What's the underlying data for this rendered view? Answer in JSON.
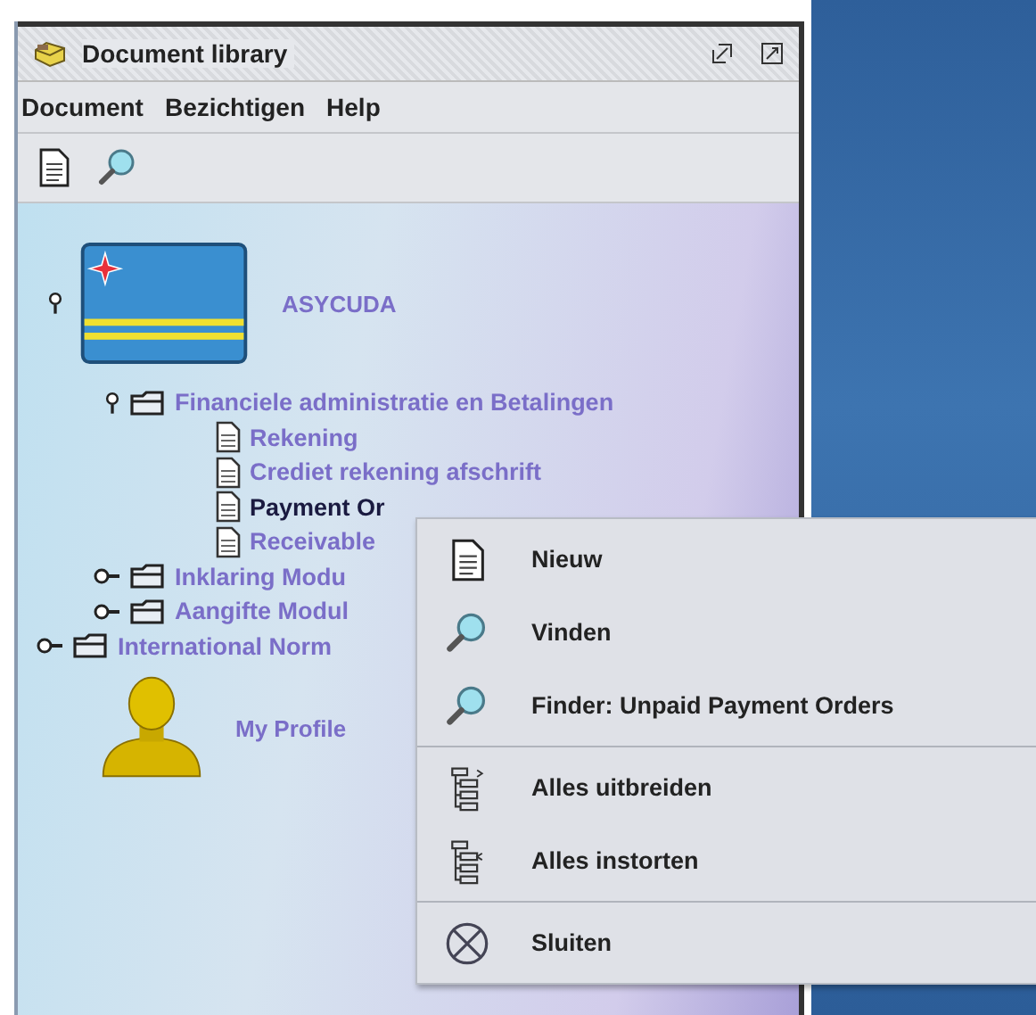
{
  "window": {
    "title": "Document library"
  },
  "menu_bar": [
    {
      "label": "Document"
    },
    {
      "label": "Bezichtigen"
    },
    {
      "label": "Help"
    }
  ],
  "toolbar": [
    {
      "kind": "new"
    },
    {
      "kind": "find"
    }
  ],
  "tree": [
    {
      "kind": "flag",
      "label": "ASYCUDA",
      "expanded": true,
      "selected": false,
      "children": [
        {
          "kind": "folder",
          "label": "Financiele administratie en Betalingen",
          "expanded": true,
          "selected": false,
          "children": [
            {
              "kind": "document",
              "label": "Rekening",
              "selected": false
            },
            {
              "kind": "document",
              "label": "Crediet rekening afschrift",
              "selected": false
            },
            {
              "kind": "document",
              "label": "Payment Or",
              "selected": true
            },
            {
              "kind": "document",
              "label": "Receivable",
              "selected": false
            }
          ]
        },
        {
          "kind": "folder",
          "label": "Inklaring Modu",
          "expanded": false,
          "selected": false
        },
        {
          "kind": "folder",
          "label": "Aangifte Modul",
          "expanded": false,
          "selected": false
        }
      ]
    },
    {
      "kind": "folder",
      "label": "International Norm",
      "expanded": false,
      "selected": false
    },
    {
      "kind": "profile",
      "label": "My Profile",
      "selected": false
    }
  ],
  "context_menu": [
    [
      {
        "kind": "new",
        "label": "Nieuw"
      },
      {
        "kind": "find",
        "label": "Vinden"
      },
      {
        "kind": "find",
        "label": "Finder: Unpaid Payment Orders"
      }
    ],
    [
      {
        "kind": "expand",
        "label": "Alles uitbreiden"
      },
      {
        "kind": "collapse",
        "label": "Alles instorten"
      }
    ],
    [
      {
        "kind": "close",
        "label": "Sluiten"
      }
    ]
  ]
}
